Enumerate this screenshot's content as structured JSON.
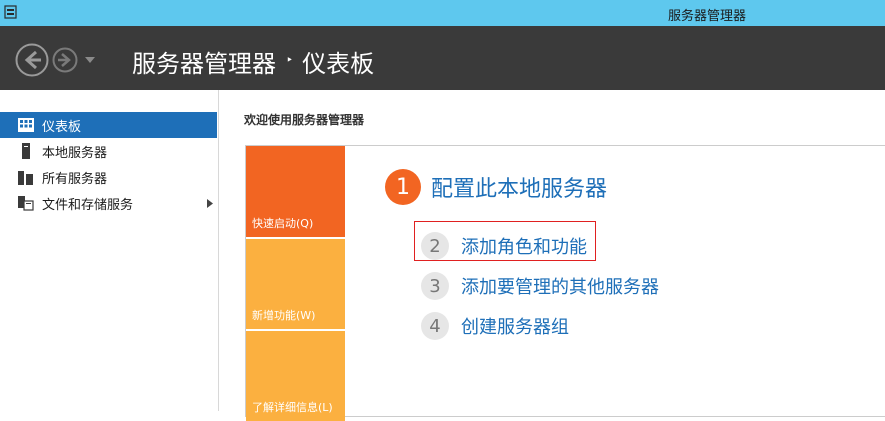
{
  "window": {
    "title": "服务器管理器"
  },
  "header": {
    "breadcrumb": [
      "服务器管理器",
      "仪表板"
    ],
    "separator": "‣"
  },
  "sidebar": {
    "items": [
      {
        "label": "仪表板",
        "icon": "dashboard-icon",
        "active": true
      },
      {
        "label": "本地服务器",
        "icon": "server-icon"
      },
      {
        "label": "所有服务器",
        "icon": "servers-icon"
      },
      {
        "label": "文件和存储服务",
        "icon": "file-storage-icon",
        "has_submenu": true
      }
    ]
  },
  "main": {
    "welcome": "欢迎使用服务器管理器",
    "tiles": [
      "快速启动(Q)",
      "新增功能(W)",
      "了解详细信息(L)"
    ],
    "primary_step": {
      "number": "1",
      "label": "配置此本地服务器"
    },
    "steps": [
      {
        "number": "2",
        "label": "添加角色和功能"
      },
      {
        "number": "3",
        "label": "添加要管理的其他服务器"
      },
      {
        "number": "4",
        "label": "创建服务器组"
      }
    ]
  },
  "colors": {
    "titlebar": "#5ec8ee",
    "header": "#3a3a3a",
    "sidebar_active": "#1e6fb8",
    "link": "#1e6fb8",
    "tile_primary": "#f26522",
    "tile_secondary": "#fbb040",
    "highlight": "#e02020"
  }
}
